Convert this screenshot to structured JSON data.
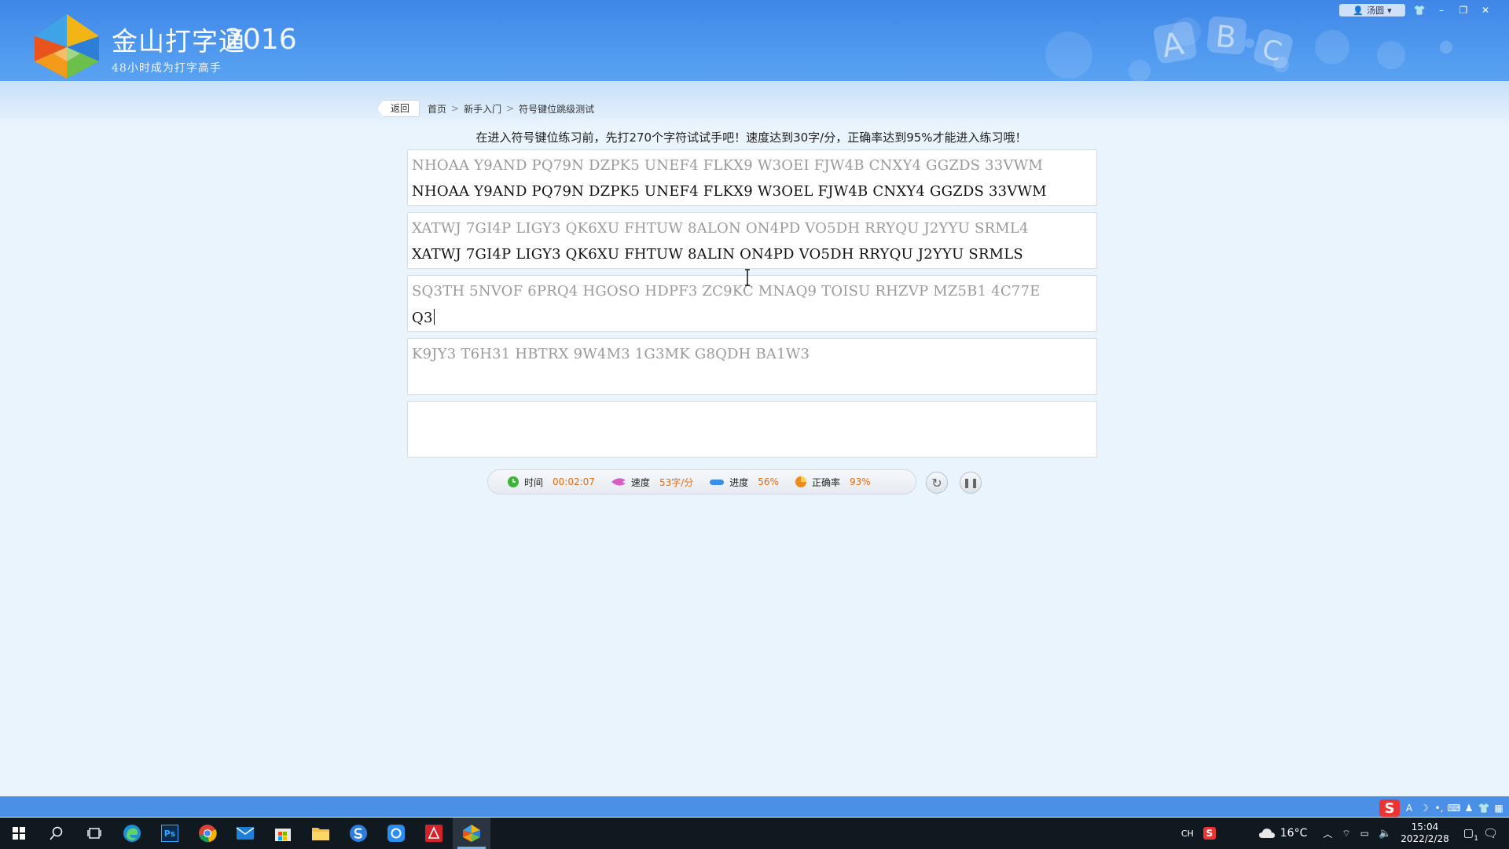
{
  "app": {
    "name": "金山打字通",
    "year": "2016",
    "slogan": "48小时成为打字高手"
  },
  "window": {
    "user_name": "汤圆"
  },
  "breadcrumb": {
    "back_label": "返回",
    "items": [
      "首页",
      "新手入门",
      "符号键位跳级测试"
    ]
  },
  "instruction": "在进入符号键位练习前，先打270个字符试试手吧！速度达到30字/分，正确率达到95%才能进入练习哦！",
  "lines": [
    {
      "source": "NHOAA Y9AND PQ79N DZPK5 UNEF4 FLKX9 W3OEI FJW4B CNXY4 GGZDS 33VWM",
      "typed": "NHOAA Y9AND PQ79N DZPK5 UNEF4 FLKX9 W3OEL FJW4B CNXY4 GGZDS 33VWM"
    },
    {
      "source": "XATWJ 7GI4P LIGY3 QK6XU FHTUW 8ALON ON4PD VO5DH RRYQU J2YYU SRML4",
      "typed": "XATWJ 7GI4P LIGY3 QK6XU FHTUW 8ALIN ON4PD VO5DH RRYQU J2YYU SRMLS"
    },
    {
      "source": "SQ3TH 5NVOF 6PRQ4 HGOSO HDPF3 ZC9KC MNAQ9 TOISU RHZVP MZ5B1 4C77E",
      "typed": "Q3"
    },
    {
      "source": "K9JY3 T6H31 HBTRX 9W4M3 1G3MK G8QDH BA1W3",
      "typed": ""
    },
    {
      "source": "",
      "typed": ""
    }
  ],
  "stats": {
    "time_label": "时间",
    "time_value": "00:02:07",
    "speed_label": "速度",
    "speed_value": "53字/分",
    "progress_label": "进度",
    "progress_value": "56%",
    "accuracy_label": "正确率",
    "accuracy_value": "93%"
  },
  "taskbar": {
    "lang": "CH",
    "weather": "16°C",
    "time": "15:04",
    "date": "2022/2/28",
    "notification_count": "1"
  }
}
